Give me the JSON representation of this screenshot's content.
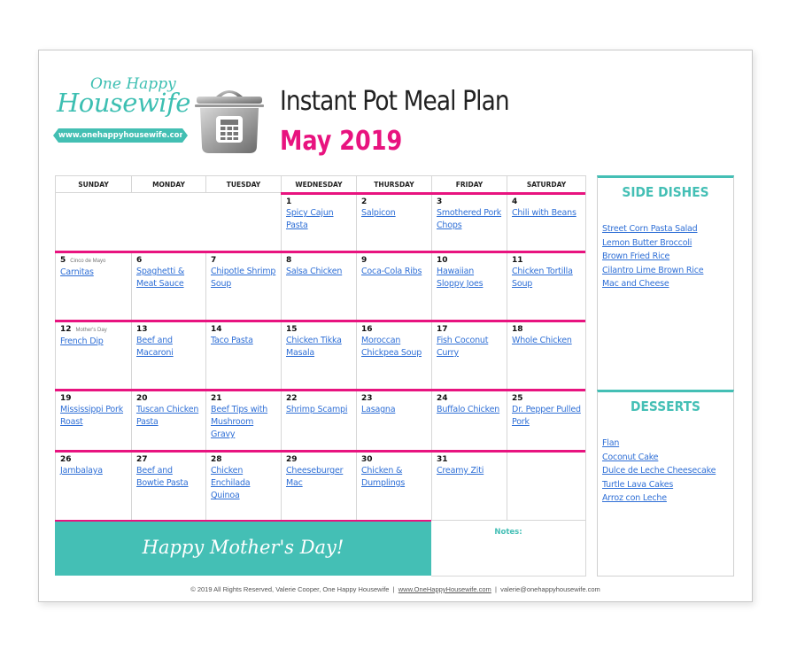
{
  "logo": {
    "script_top": "One Happy",
    "script_main": "Housewife",
    "url": "www.onehappyhousewife.com"
  },
  "header": {
    "title": "Instant Pot Meal Plan",
    "month": "May 2019",
    "icon": "instant-pot-icon"
  },
  "calendar": {
    "weekdays": [
      "SUNDAY",
      "MONDAY",
      "TUESDAY",
      "WEDNESDAY",
      "THURSDAY",
      "FRIDAY",
      "SATURDAY"
    ],
    "days": [
      {
        "day": "1",
        "holiday": "",
        "meal": "Spicy Cajun Pasta"
      },
      {
        "day": "2",
        "holiday": "",
        "meal": "Salpicon"
      },
      {
        "day": "3",
        "holiday": "",
        "meal": "Smothered Pork Chops"
      },
      {
        "day": "4",
        "holiday": "",
        "meal": "Chili with Beans"
      },
      {
        "day": "5",
        "holiday": "Cinco de Mayo",
        "meal": "Carnitas"
      },
      {
        "day": "6",
        "holiday": "",
        "meal": "Spaghetti & Meat Sauce"
      },
      {
        "day": "7",
        "holiday": "",
        "meal": "Chipotle Shrimp Soup"
      },
      {
        "day": "8",
        "holiday": "",
        "meal": "Salsa Chicken"
      },
      {
        "day": "9",
        "holiday": "",
        "meal": "Coca-Cola Ribs"
      },
      {
        "day": "10",
        "holiday": "",
        "meal": "Hawaiian Sloppy Joes"
      },
      {
        "day": "11",
        "holiday": "",
        "meal": "Chicken Tortilla Soup"
      },
      {
        "day": "12",
        "holiday": "Mother's Day",
        "meal": "French Dip"
      },
      {
        "day": "13",
        "holiday": "",
        "meal": "Beef and Macaroni"
      },
      {
        "day": "14",
        "holiday": "",
        "meal": "Taco Pasta"
      },
      {
        "day": "15",
        "holiday": "",
        "meal": "Chicken Tikka Masala"
      },
      {
        "day": "16",
        "holiday": "",
        "meal": "Moroccan Chickpea Soup"
      },
      {
        "day": "17",
        "holiday": "",
        "meal": "Fish Coconut Curry"
      },
      {
        "day": "18",
        "holiday": "",
        "meal": "Whole Chicken"
      },
      {
        "day": "19",
        "holiday": "",
        "meal": "Mississippi Pork Roast"
      },
      {
        "day": "20",
        "holiday": "",
        "meal": "Tuscan Chicken Pasta"
      },
      {
        "day": "21",
        "holiday": "",
        "meal": "Beef Tips with Mushroom Gravy"
      },
      {
        "day": "22",
        "holiday": "",
        "meal": "Shrimp Scampi"
      },
      {
        "day": "23",
        "holiday": "",
        "meal": "Lasagna"
      },
      {
        "day": "24",
        "holiday": "",
        "meal": "Buffalo Chicken"
      },
      {
        "day": "25",
        "holiday": "",
        "meal": "Dr. Pepper Pulled Pork"
      },
      {
        "day": "26",
        "holiday": "",
        "meal": "Jambalaya"
      },
      {
        "day": "27",
        "holiday": "",
        "meal": "Beef and Bowtie Pasta"
      },
      {
        "day": "28",
        "holiday": "",
        "meal": "Chicken Enchilada Quinoa"
      },
      {
        "day": "29",
        "holiday": "",
        "meal": "Cheeseburger Mac"
      },
      {
        "day": "30",
        "holiday": "",
        "meal": "Chicken & Dumplings"
      },
      {
        "day": "31",
        "holiday": "",
        "meal": "Creamy Ziti"
      }
    ],
    "banner": "Happy Mother's Day!",
    "notes_label": "Notes:"
  },
  "side_dishes": {
    "title": "SIDE DISHES",
    "items": [
      "Street Corn Pasta Salad",
      "Lemon Butter Broccoli",
      "Brown Fried Rice",
      "Cilantro Lime Brown Rice",
      "Mac and Cheese"
    ]
  },
  "desserts": {
    "title": "DESSERTS",
    "items": [
      "Flan",
      "Coconut Cake",
      "Dulce de Leche Cheesecake",
      "Turtle Lava Cakes",
      "Arroz con Leche"
    ]
  },
  "footer": {
    "copyright": "© 2019 All Rights Reserved, Valerie Cooper, One Happy Housewife",
    "sep": "|",
    "website": "www.OneHappyHousewife.com",
    "email": "valerie@onehappyhousewife.com"
  },
  "colors": {
    "pink": "#e8137f",
    "teal": "#44bfb5",
    "link": "#2f6fd6"
  }
}
